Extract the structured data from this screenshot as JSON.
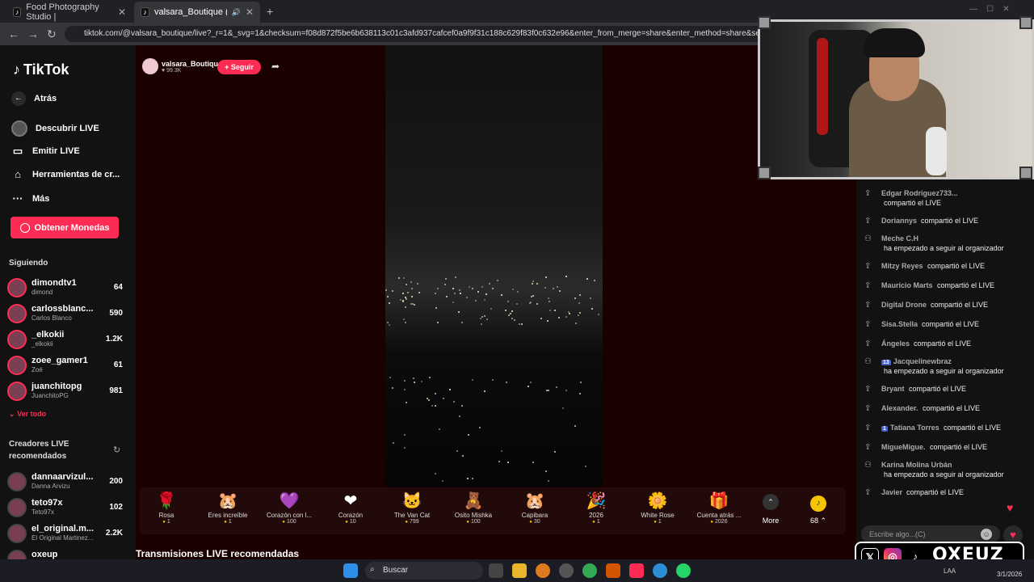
{
  "browser": {
    "tabs": [
      {
        "title": "Food Photography Studio |",
        "active": false
      },
      {
        "title": "valsara_Boutique (@valsara",
        "active": true
      }
    ],
    "url": "tiktok.com/@valsara_boutique/live?_r=1&_svg=1&checksum=f08d872f5be6b638113c01c3afd937cafcef0a9f9f31c188c629f83f0c632e96&enter_from_merge=share&enter_method=share&sec_user_id=MS"
  },
  "sidebar": {
    "logo": "TikTok",
    "back": "Atrás",
    "nav": [
      {
        "label": "Descubrir LIVE",
        "icon": "live-icon"
      },
      {
        "label": "Emitir LIVE",
        "icon": "camera-icon"
      },
      {
        "label": "Herramientas de cr...",
        "icon": "home-icon"
      },
      {
        "label": "Más",
        "icon": "more-icon"
      }
    ],
    "coins_button": "Obtener Monedas",
    "following_title": "Siguiendo",
    "following": [
      {
        "name": "dimondtv1",
        "sub": "dimond",
        "count": "64"
      },
      {
        "name": "carlossblanc...",
        "sub": "Carlos Blanco",
        "count": "590"
      },
      {
        "name": "_elkokii",
        "sub": "_elkokii",
        "count": "1.2K"
      },
      {
        "name": "zoee_gamer1",
        "sub": "Zoé",
        "count": "61"
      },
      {
        "name": "juanchitopg",
        "sub": "JuanchitoPG",
        "count": "981"
      }
    ],
    "see_all": "Ver todo",
    "recommended_title_1": "Creadores LIVE",
    "recommended_title_2": "recomendados",
    "recommended": [
      {
        "name": "dannaarvizul...",
        "sub": "Danna Arvizu",
        "count": "200"
      },
      {
        "name": "teto97x",
        "sub": "Teto97x",
        "count": "102"
      },
      {
        "name": "el_original.m...",
        "sub": "El Original Martinez...",
        "count": "2.2K"
      },
      {
        "name": "oxeup",
        "sub": "",
        "count": ""
      }
    ]
  },
  "stream": {
    "host_name": "valsara_Boutique",
    "likes": "99.3K",
    "follow_label": "+ Seguir"
  },
  "gifts": [
    {
      "name": "Rosa",
      "price": "1",
      "icon": "🌹"
    },
    {
      "name": "Eres increíble",
      "price": "1",
      "icon": "🐹"
    },
    {
      "name": "Corazón con l...",
      "price": "100",
      "icon": "💜"
    },
    {
      "name": "Corazón",
      "price": "10",
      "icon": "❤"
    },
    {
      "name": "The Van Cat",
      "price": "799",
      "icon": "🐱"
    },
    {
      "name": "Osito Mishka",
      "price": "100",
      "icon": "🧸"
    },
    {
      "name": "Capibara",
      "price": "30",
      "icon": "🐹"
    },
    {
      "name": "2026",
      "price": "1",
      "icon": "🎉"
    },
    {
      "name": "White Rose",
      "price": "1",
      "icon": "🌼"
    },
    {
      "name": "Cuenta atrás ...",
      "price": "2026",
      "icon": "🎁"
    }
  ],
  "more_gifts": "More",
  "coin_balance": "68",
  "recs_title": "Transmisiones LIVE recomendadas",
  "chat": [
    {
      "user": "Edgar Rodriguez733...",
      "text": "",
      "line2": "compartió el LIVE",
      "icon": "share-icon"
    },
    {
      "user": "Doriannys",
      "text": "compartió el LIVE",
      "icon": "share-icon"
    },
    {
      "user": "Meche C.H",
      "text": "",
      "line2": "ha empezado a seguir al organizador",
      "icon": "follow-icon"
    },
    {
      "user": "Mitzy Reyes",
      "text": "compartió el LIVE",
      "icon": "share-icon"
    },
    {
      "user": "Mauricio Marts",
      "text": "compartió el LIVE",
      "icon": "share-icon"
    },
    {
      "user": "Digital Drone",
      "text": "compartió el LIVE",
      "icon": "share-icon"
    },
    {
      "user": "Sisa.Stella",
      "text": "compartió el LIVE",
      "icon": "share-icon"
    },
    {
      "user": "Ángeles",
      "text": "compartió el LIVE",
      "icon": "share-icon"
    },
    {
      "user": "Jacquelinewbraz",
      "badge": "13",
      "text": "",
      "line2": "ha empezado a seguir al organizador",
      "icon": "follow-icon"
    },
    {
      "user": "Bryant",
      "text": "compartió el LIVE",
      "icon": "share-icon"
    },
    {
      "user": "Alexander.",
      "text": "compartió el LIVE",
      "icon": "share-icon"
    },
    {
      "user": "Tatiana Torres",
      "badge": "1",
      "text": "compartió el LIVE",
      "icon": "share-icon"
    },
    {
      "user": "MigueMigue.",
      "text": "compartió el LIVE",
      "icon": "share-icon"
    },
    {
      "user": "Karina Molina Urbán",
      "text": "",
      "line2": "ha empezado a seguir al organizador",
      "icon": "follow-icon"
    },
    {
      "user": "Javier",
      "text": "compartió el LIVE",
      "icon": "share-icon"
    }
  ],
  "chat_placeholder": "Escribe algo...(C)",
  "overlay_brand": "OXEUZ",
  "taskbar": {
    "search": "Buscar",
    "lang": "LAA",
    "date": "3/1/2026"
  },
  "colors": {
    "accent": "#fe2c55",
    "coin": "#f5c400",
    "stage_bg": "#1b0000"
  }
}
